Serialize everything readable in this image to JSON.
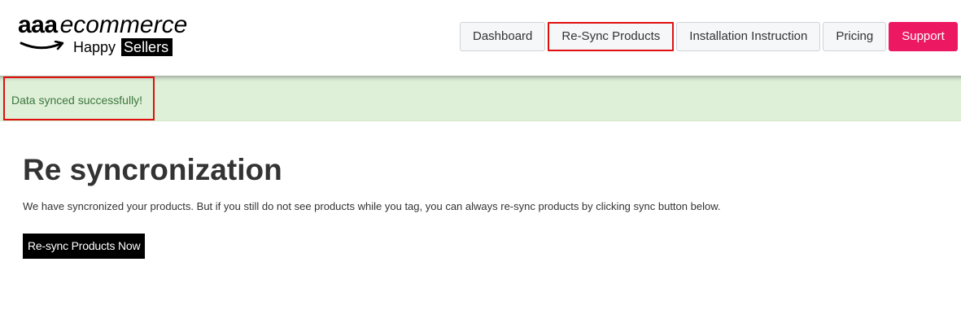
{
  "logo": {
    "brand_bold": "aaa",
    "brand_rest": "ecommerce",
    "tagline_prefix": "Happy",
    "tagline_highlight": "Sellers"
  },
  "nav": {
    "items": [
      {
        "label": "Dashboard"
      },
      {
        "label": "Re-Sync Products"
      },
      {
        "label": "Installation Instruction"
      },
      {
        "label": "Pricing"
      },
      {
        "label": "Support"
      }
    ],
    "active": "Re-Sync Products"
  },
  "alert": {
    "message": "Data synced successfully!"
  },
  "main": {
    "title": "Re syncronization",
    "description": "We have syncronized your products. But if you still do not see products while you tag, you can always re-sync products by clicking sync button below.",
    "button_label": "Re-sync Products Now"
  },
  "colors": {
    "support_button": "#ec1861",
    "highlight_border": "#e01010",
    "alert_background": "#dff0d8",
    "alert_text": "#3c763d",
    "primary_button": "#000000"
  }
}
